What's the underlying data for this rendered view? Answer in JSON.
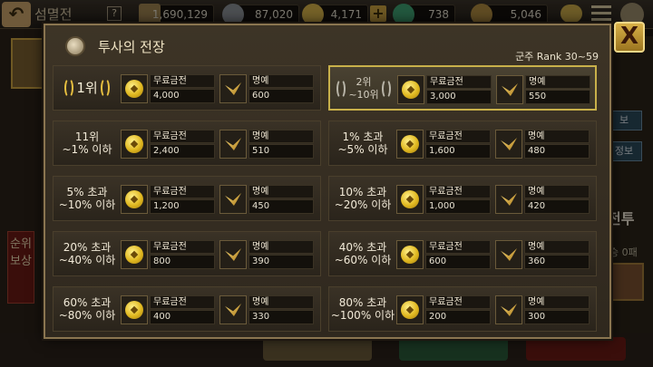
{
  "topbar": {
    "back_icon": "back-arrow-icon",
    "screen_title": "섬멸전",
    "help_label": "?",
    "resources": [
      {
        "name": "gold-bar",
        "value": "1,690,129"
      },
      {
        "name": "silver-coin",
        "value": "87,020"
      },
      {
        "name": "gold-coin",
        "value": "4,171"
      },
      {
        "name": "jade",
        "value": "738"
      },
      {
        "name": "honor",
        "value": "5,046"
      }
    ],
    "plus_label": "+"
  },
  "background": {
    "rank_reward_tab": "순위보상",
    "info_btn_1": "보",
    "info_btn_2": "정보",
    "battle_label": "전투",
    "battle_sub": "승 0패"
  },
  "dialog": {
    "title": "투사의 전장",
    "rank_range": "군주 Rank 30~59",
    "close_label": "X",
    "coin_label": "무료금전",
    "honor_label": "명예",
    "rows": [
      {
        "rank": "1위",
        "coin": "4,000",
        "honor": "600"
      },
      {
        "rank": "2위\n~10위",
        "coin": "3,000",
        "honor": "550"
      },
      {
        "rank": "11위\n~1% 이하",
        "coin": "2,400",
        "honor": "510"
      },
      {
        "rank": "1% 초과\n~5% 이하",
        "coin": "1,600",
        "honor": "480"
      },
      {
        "rank": "5% 초과\n~10% 이하",
        "coin": "1,200",
        "honor": "450"
      },
      {
        "rank": "10% 초과\n~20% 이하",
        "coin": "1,000",
        "honor": "420"
      },
      {
        "rank": "20% 초과\n~40% 이하",
        "coin": "800",
        "honor": "390"
      },
      {
        "rank": "40% 초과\n~60% 이하",
        "coin": "600",
        "honor": "360"
      },
      {
        "rank": "60% 초과\n~80% 이하",
        "coin": "400",
        "honor": "330"
      },
      {
        "rank": "80% 초과\n~100% 이하",
        "coin": "200",
        "honor": "300"
      }
    ]
  }
}
